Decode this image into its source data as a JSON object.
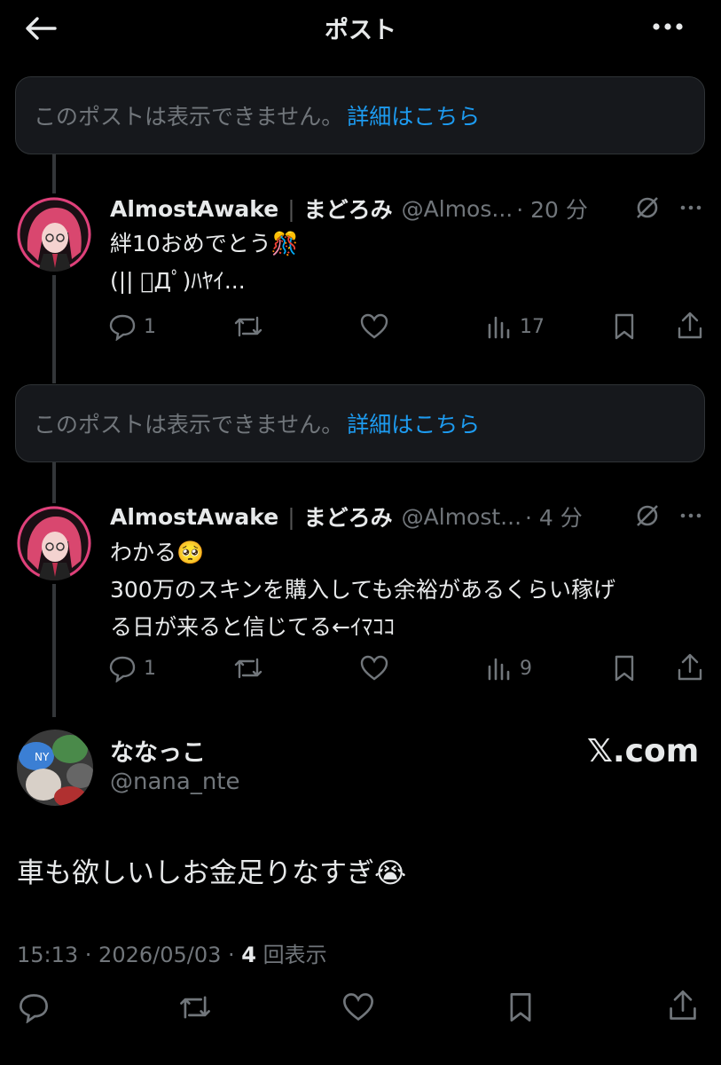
{
  "header": {
    "title": "ポスト"
  },
  "notice1": {
    "text": "このポストは表示できません。",
    "link": "詳細はこちら"
  },
  "notice2": {
    "text": "このポストは表示できません。",
    "link": "詳細はこちら"
  },
  "tweet1": {
    "name": "AlmostAwake",
    "name2": "まどろみ",
    "handle": "@Almos...",
    "time": "· 20 分",
    "line1": "絆10おめでとう🎊",
    "line2": "(|| ﾟДﾟ)ﾊﾔｲ...",
    "replies": "1",
    "views": "17"
  },
  "tweet2": {
    "name": "AlmostAwake",
    "name2": "まどろみ",
    "handle": "@Almost...",
    "time": "· 4 分",
    "line1": "わかる🥺",
    "line2": "300万のスキンを購入しても余裕があるくらい稼げ",
    "line3": "る日が来ると信じてる←ｲﾏｺｺ",
    "replies": "1",
    "views": "9"
  },
  "main": {
    "name": "ななっこ",
    "handle": "@nana_nte",
    "badge": "𝕏.com",
    "text": "車も欲しいしお金足りなすぎ😭",
    "time": "15:13 · 2026/05/03 ·",
    "views_count": "4",
    "views_label": "回表示"
  },
  "icons": [
    "back-arrow-icon",
    "more-icon",
    "reply-icon",
    "retweet-icon",
    "like-icon",
    "views-icon",
    "bookmark-icon",
    "share-icon",
    "grok-icon"
  ],
  "colors": {
    "background": "#000000",
    "link": "#1d9bf0",
    "muted": "#71767b",
    "text": "#e7e9ea"
  }
}
